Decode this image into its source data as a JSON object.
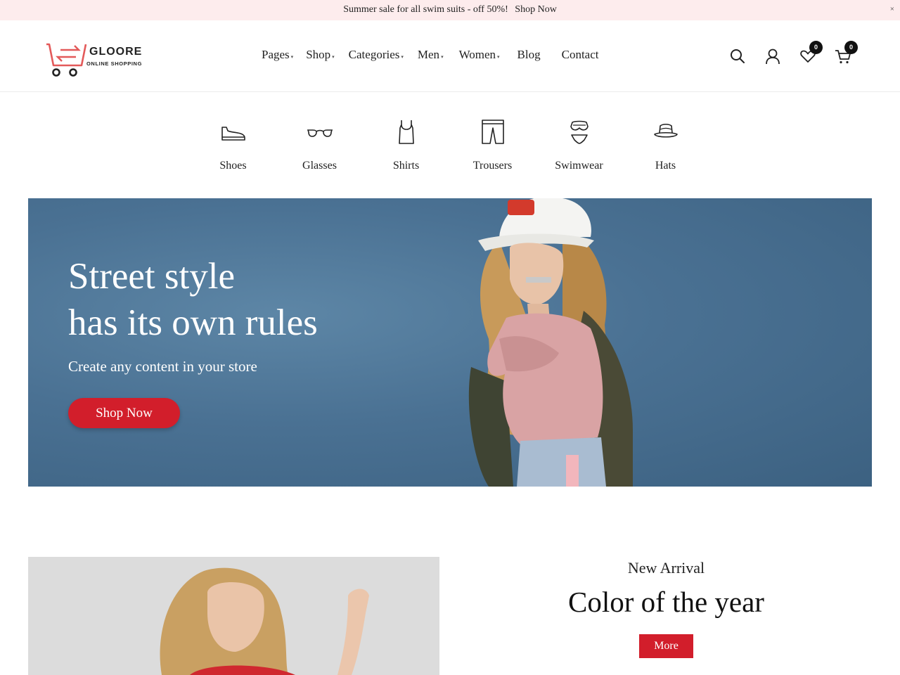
{
  "announcement": {
    "text": "Summer sale for all swim suits - off 50%!",
    "link": "Shop Now",
    "close": "×"
  },
  "brand": {
    "name": "GLOORE",
    "tagline": "ONLINE SHOPPING",
    "accent": "#e35a5a"
  },
  "nav": {
    "items": [
      {
        "label": "Pages",
        "caret": "▾"
      },
      {
        "label": "Shop",
        "caret": "▾"
      },
      {
        "label": "Categories",
        "caret": "▾"
      },
      {
        "label": "Men",
        "caret": "▾"
      },
      {
        "label": "Women",
        "caret": "▾"
      },
      {
        "label": "Blog",
        "caret": ""
      },
      {
        "label": "Contact",
        "caret": ""
      }
    ]
  },
  "header_actions": {
    "icons": [
      "search-icon",
      "user-icon",
      "heart-icon",
      "cart-icon"
    ],
    "wishlist_count": "0",
    "cart_count": "0"
  },
  "categories": [
    {
      "label": "Shoes",
      "icon": "shoe-icon"
    },
    {
      "label": "Glasses",
      "icon": "glasses-icon"
    },
    {
      "label": "Shirts",
      "icon": "tank-top-icon"
    },
    {
      "label": "Trousers",
      "icon": "shorts-icon"
    },
    {
      "label": "Swimwear",
      "icon": "bikini-icon"
    },
    {
      "label": "Hats",
      "icon": "hat-icon"
    }
  ],
  "hero": {
    "title_line1": "Street style",
    "title_line2": "has its own rules",
    "subtitle": "Create any content in your store",
    "cta": "Shop Now",
    "background": "#4a7193"
  },
  "promo": {
    "kicker": "New Arrival",
    "title": "Color of the year",
    "cta": "More"
  },
  "colors": {
    "primary_red": "#d21e2b",
    "topbar_bg": "#fdeced",
    "text": "#222222"
  }
}
